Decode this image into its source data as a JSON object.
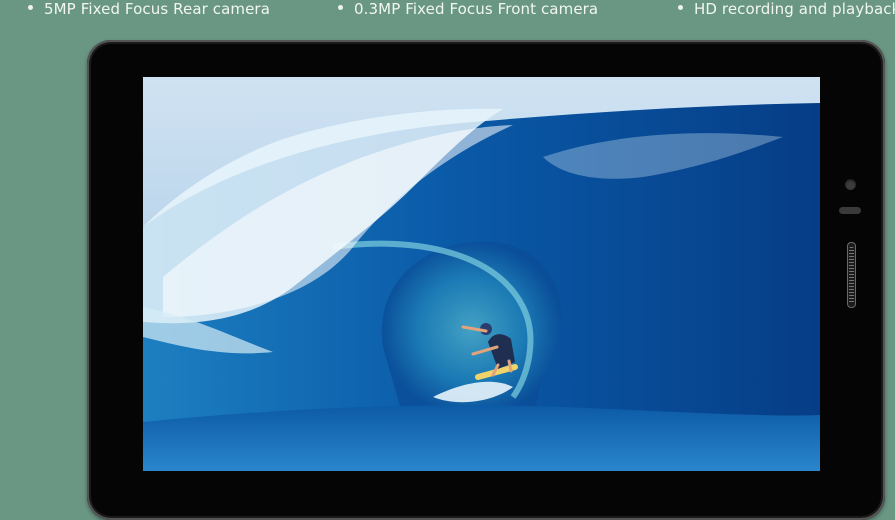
{
  "features": [
    {
      "label": "5MP Fixed Focus Rear camera"
    },
    {
      "label": "0.3MP Fixed Focus Front camera"
    },
    {
      "label": "HD recording and playback"
    }
  ],
  "colors": {
    "page_background": "#6a9684",
    "bullet_text": "#f2f6f3",
    "tablet_bezel": "#050505"
  },
  "icons": {
    "bullet": "bullet-dot-icon",
    "front_camera": "front-camera-icon",
    "sensor": "sensor-icon",
    "speaker": "speaker-grill-icon"
  }
}
